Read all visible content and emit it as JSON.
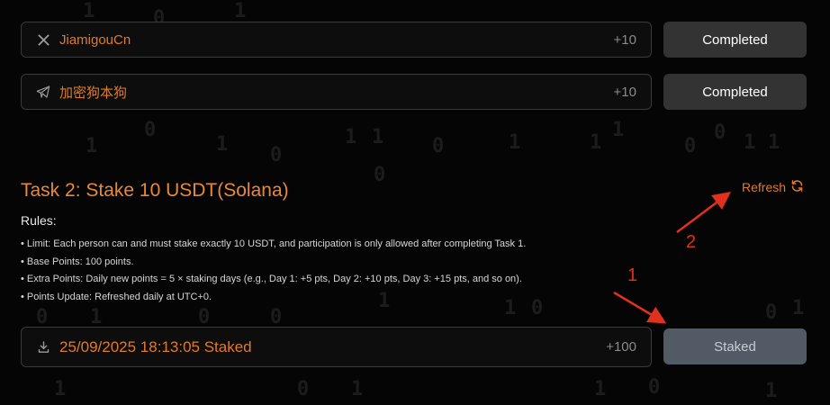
{
  "task1": {
    "rows": [
      {
        "icon": "x-logo-icon",
        "label": "JiamigouCn",
        "points": "+10",
        "button": "Completed"
      },
      {
        "icon": "telegram-icon",
        "label": "加密狗本狗",
        "points": "+10",
        "button": "Completed"
      }
    ]
  },
  "task2": {
    "title": "Task 2: Stake 10 USDT(Solana)",
    "refresh_label": "Refresh",
    "rules_heading": "Rules:",
    "rules": [
      "• Limit: Each person can and must stake exactly 10 USDT, and participation is only allowed after completing Task 1.",
      "• Base Points: 100 points.",
      "• Extra Points: Daily new points = 5 × staking days (e.g., Day 1: +5 pts, Day 2: +10 pts, Day 3: +15 pts, and so on).",
      "• Points Update: Refreshed daily at UTC+0."
    ],
    "stake_row": {
      "icon": "download-icon",
      "label": "25/09/2025 18:13:05 Staked",
      "points": "+100",
      "button": "Staked"
    }
  },
  "annotations": {
    "marker_1": "1",
    "marker_2": "2"
  },
  "colors": {
    "accent": "#e07b2a",
    "annotation": "#e0301e",
    "background": "#050505"
  }
}
